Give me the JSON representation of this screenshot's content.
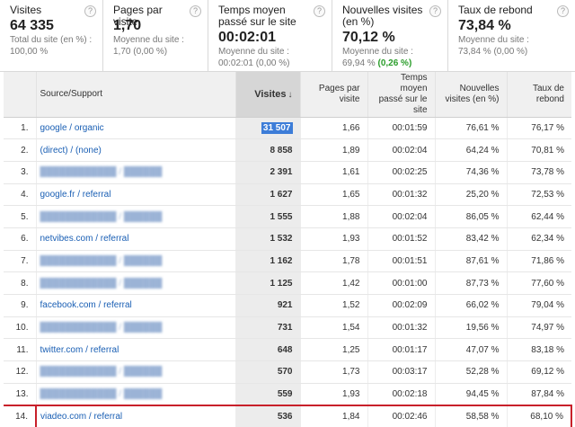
{
  "summary": [
    {
      "title": "Visites",
      "value": "64 335",
      "sub1": "Total du site (en %) :",
      "sub2": "100,00 %",
      "delta": ""
    },
    {
      "title": "Pages par visite",
      "value": "1,70",
      "sub1": "Moyenne du site :",
      "sub2": "1,70 (0,00 %)",
      "delta": ""
    },
    {
      "title": "Temps moyen passé sur le site",
      "value": "00:02:01",
      "sub1": "Moyenne du site :",
      "sub2": "00:02:01 (0,00 %)",
      "delta": ""
    },
    {
      "title": "Nouvelles visites (en %)",
      "value": "70,12 %",
      "sub1": "Moyenne du site :",
      "sub2": "69,94 % ",
      "delta": "(0,26 %)"
    },
    {
      "title": "Taux de rebond",
      "value": "73,84 %",
      "sub1": "Moyenne du site :",
      "sub2": "73,84 % (0,00 %)",
      "delta": ""
    }
  ],
  "help_glyph": "?",
  "table": {
    "headers": {
      "source": "Source/Support",
      "visits": "Visites",
      "sort_glyph": "↓",
      "pages": "Pages par visite",
      "time": "Temps moyen passé sur le site",
      "new": "Nouvelles visites (en %)",
      "bounce": "Taux de rebond"
    },
    "rows": [
      {
        "idx": "1.",
        "source": "google / organic",
        "blurred": false,
        "visits": "31 507",
        "pages": "1,66",
        "time": "00:01:59",
        "new": "76,61 %",
        "bounce": "76,17 %"
      },
      {
        "idx": "2.",
        "source": "(direct) / (none)",
        "blurred": false,
        "visits": "8 858",
        "pages": "1,89",
        "time": "00:02:04",
        "new": "64,24 %",
        "bounce": "70,81 %"
      },
      {
        "idx": "3.",
        "source": "",
        "blurred": true,
        "visits": "2 391",
        "pages": "1,61",
        "time": "00:02:25",
        "new": "74,36 %",
        "bounce": "73,78 %"
      },
      {
        "idx": "4.",
        "source": "google.fr / referral",
        "blurred": false,
        "visits": "1 627",
        "pages": "1,65",
        "time": "00:01:32",
        "new": "25,20 %",
        "bounce": "72,53 %"
      },
      {
        "idx": "5.",
        "source": "",
        "blurred": true,
        "visits": "1 555",
        "pages": "1,88",
        "time": "00:02:04",
        "new": "86,05 %",
        "bounce": "62,44 %"
      },
      {
        "idx": "6.",
        "source": "netvibes.com / referral",
        "blurred": false,
        "visits": "1 532",
        "pages": "1,93",
        "time": "00:01:52",
        "new": "83,42 %",
        "bounce": "62,34 %"
      },
      {
        "idx": "7.",
        "source": "",
        "blurred": true,
        "visits": "1 162",
        "pages": "1,78",
        "time": "00:01:51",
        "new": "87,61 %",
        "bounce": "71,86 %"
      },
      {
        "idx": "8.",
        "source": "",
        "blurred": true,
        "visits": "1 125",
        "pages": "1,42",
        "time": "00:01:00",
        "new": "87,73 %",
        "bounce": "77,60 %"
      },
      {
        "idx": "9.",
        "source": "facebook.com / referral",
        "blurred": false,
        "visits": "921",
        "pages": "1,52",
        "time": "00:02:09",
        "new": "66,02 %",
        "bounce": "79,04 %"
      },
      {
        "idx": "10.",
        "source": "",
        "blurred": true,
        "visits": "731",
        "pages": "1,54",
        "time": "00:01:32",
        "new": "19,56 %",
        "bounce": "74,97 %"
      },
      {
        "idx": "11.",
        "source": "twitter.com / referral",
        "blurred": false,
        "visits": "648",
        "pages": "1,25",
        "time": "00:01:17",
        "new": "47,07 %",
        "bounce": "83,18 %"
      },
      {
        "idx": "12.",
        "source": "",
        "blurred": true,
        "visits": "570",
        "pages": "1,73",
        "time": "00:03:17",
        "new": "52,28 %",
        "bounce": "69,12 %"
      },
      {
        "idx": "13.",
        "source": "",
        "blurred": true,
        "visits": "559",
        "pages": "1,93",
        "time": "00:02:18",
        "new": "94,45 %",
        "bounce": "87,84 %"
      },
      {
        "idx": "14.",
        "source": "viadeo.com / referral",
        "blurred": false,
        "visits": "536",
        "pages": "1,84",
        "time": "00:02:46",
        "new": "58,58 %",
        "bounce": "68,10 %"
      }
    ],
    "highlighted_visits_row": 0,
    "highlighted_row": 13
  }
}
